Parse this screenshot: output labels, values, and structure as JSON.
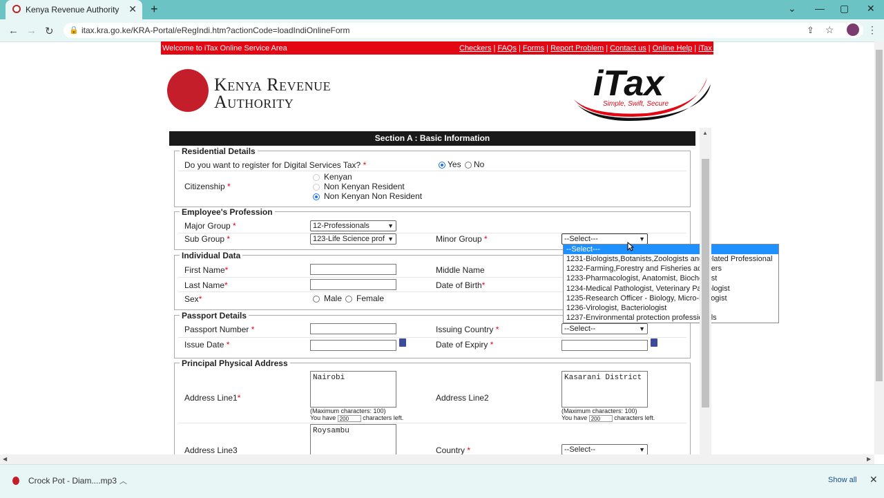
{
  "browser": {
    "tab_title": "Kenya Revenue Authority",
    "url": "itax.kra.go.ke/KRA-Portal/eRegIndi.htm?actionCode=loadIndiOnlineForm"
  },
  "header": {
    "welcome": "Welcome to iTax Online Service Area",
    "links": [
      "Checkers",
      "FAQs",
      "Forms",
      "Report Problem",
      "Contact us",
      "Online Help",
      "iTax Videos"
    ],
    "logo_line1": "Kenya Revenue",
    "logo_line2": "Authority",
    "itax_title": "iTax",
    "itax_tagline": "Simple, Swift, Secure"
  },
  "section_title": "Section A : Basic Information",
  "residential": {
    "legend": "Residential Details",
    "dst_question": "Do you want to register for Digital Services Tax?",
    "yes": "Yes",
    "no": "No",
    "citizenship_label": "Citizenship",
    "options": [
      "Kenyan",
      "Non Kenyan Resident",
      "Non Kenyan Non Resident"
    ]
  },
  "profession": {
    "legend": "Employee's Profession",
    "major_group_label": "Major Group",
    "major_group_value": "12-Professionals",
    "sub_group_label": "Sub Group",
    "sub_group_value": "123-Life Science prof",
    "minor_group_label": "Minor Group",
    "minor_group_value": "--Select---"
  },
  "individual": {
    "legend": "Individual Data",
    "first_name": "First Name",
    "middle_name": "Middle Name",
    "last_name": "Last Name",
    "dob": "Date of Birth",
    "sex": "Sex",
    "male": "Male",
    "female": "Female"
  },
  "passport": {
    "legend": "Passport Details",
    "number": "Passport Number",
    "issuing_country": "Issuing Country",
    "issuing_country_value": "--Select--",
    "issue_date": "Issue Date",
    "expiry": "Date of Expiry"
  },
  "address": {
    "legend": "Principal Physical Address",
    "line1_label": "Address Line1",
    "line1_value": "Nairobi",
    "line2_label": "Address Line2",
    "line2_value": "Kasarani District",
    "line3_label": "Address Line3",
    "line3_value": "Roysambu",
    "country_label": "Country",
    "country_value": "--Select--",
    "max_note": "(Maximum characters: 100)",
    "you_have": "You have",
    "chars_left": "characters left.",
    "count1": "200",
    "count2": "200"
  },
  "dropdown_options": [
    "--Select---",
    "1231-Biologists,Botanists,Zoologists and related Professional",
    "1232-Farming,Forestry and Fisheries advisers",
    "1233-Pharmacologist, Anatomist, Biochemist",
    "1234-Medical Pathologist, Veterinary Pathologist",
    "1235-Research Officer - Biology, Micro-biologist",
    "1236-Virologist, Bacteriologist",
    "1237-Environmental protection professionals"
  ],
  "download": {
    "file": "Crock Pot - Diam....mp3",
    "show_all": "Show all"
  },
  "colors": {
    "accent_red": "#e30613",
    "teal_chrome": "#6bc4c3",
    "highlight": "#1e90ff"
  }
}
